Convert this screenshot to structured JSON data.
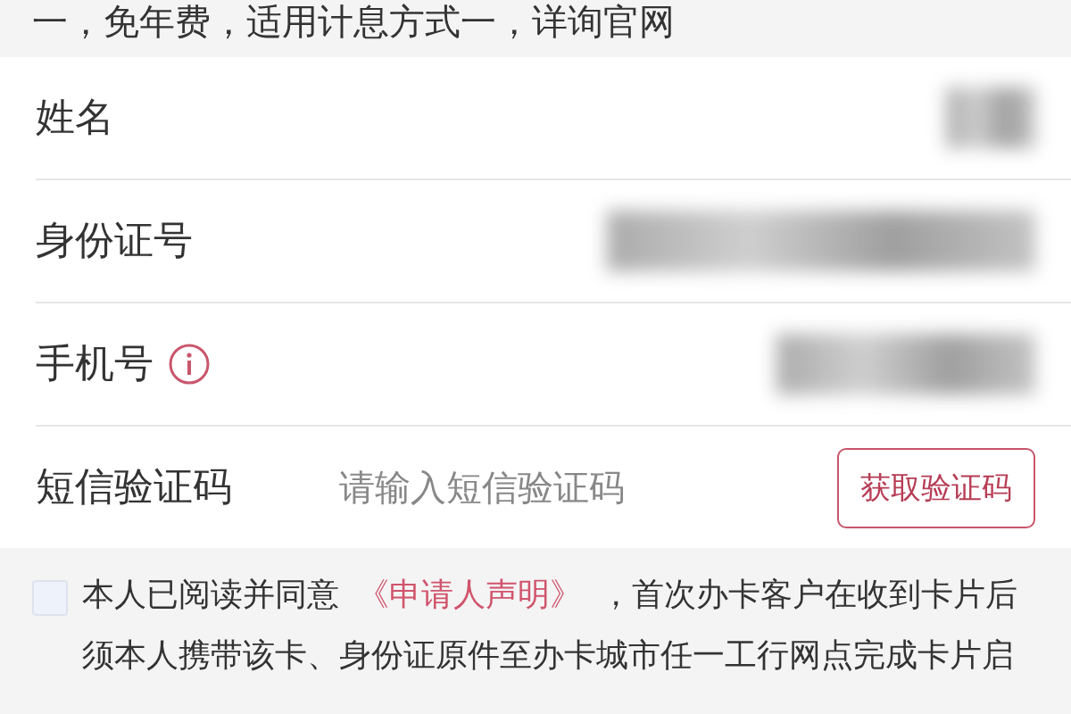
{
  "notice": "一，免年费，适用计息方式一，详询官网",
  "fields": [
    {
      "label": "姓名",
      "kind": "masked",
      "info": false
    },
    {
      "label": "身份证号",
      "kind": "masked",
      "info": false
    },
    {
      "label": "手机号",
      "kind": "masked",
      "info": true
    },
    {
      "label": "短信验证码",
      "kind": "code",
      "info": false,
      "placeholder": "请输入短信验证码",
      "button": "获取验证码"
    }
  ],
  "agreement": {
    "checked": false,
    "before": "本人已阅读并同意",
    "link": "《申请人声明》",
    "after": "，首次办卡客户在收到卡片后须本人携带该卡、身份证原件至办卡城市任一工行网点完成卡片启"
  }
}
